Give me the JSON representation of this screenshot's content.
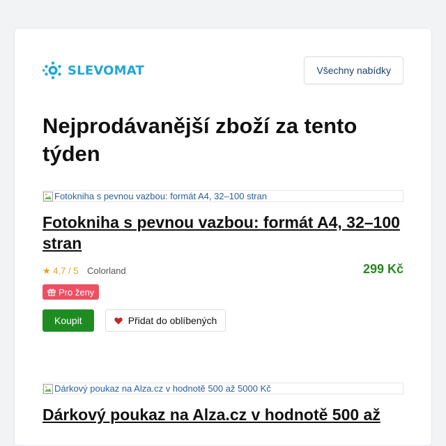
{
  "brand": {
    "name": "SLEVOMAT",
    "color": "#1fa7d9"
  },
  "header": {
    "all_offers_label": "Všechny nabídky"
  },
  "page_title": "Nejprodávanější zboží za tento týden",
  "products": [
    {
      "image_alt": "Fotokniha s pevnou vazbou: formát A4, 32–100 stran",
      "title": "Fotokniha s pevnou vazbou: formát A4, 32–100 stran",
      "rating": "★ 4,7 / 5",
      "vendor": "Colorland",
      "price": "299 Kč",
      "badge": "Pro ženy",
      "buy_label": "Koupit",
      "favorite_label": "Přidat do oblíbených"
    },
    {
      "image_alt": "Dárkový poukaz na Alza.cz v hodnotě 500 až 5000 Kč",
      "title": "Dárkový poukaz na Alza.cz v hodnotě 500 až"
    }
  ],
  "colors": {
    "price": "#27891f",
    "buy_button": "#1f8c22",
    "badge": "#ef4f63",
    "rating": "#e5a021"
  }
}
